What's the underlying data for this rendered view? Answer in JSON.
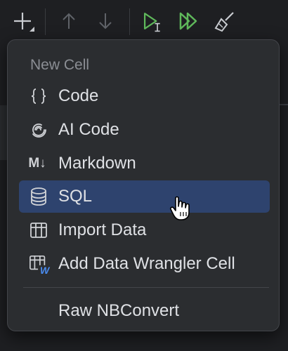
{
  "toolbar": {
    "buttons": [
      {
        "name": "add-cell-button",
        "icon": "plus-icon"
      },
      {
        "name": "move-up-button",
        "icon": "arrow-up-icon"
      },
      {
        "name": "move-down-button",
        "icon": "arrow-down-icon"
      },
      {
        "name": "run-cell-button",
        "icon": "run-cursor-icon"
      },
      {
        "name": "run-all-button",
        "icon": "run-all-icon"
      },
      {
        "name": "clear-outputs-button",
        "icon": "broom-icon"
      }
    ],
    "accent_green": "#5fb85b"
  },
  "menu": {
    "header": "New Cell",
    "items": [
      {
        "label": "Code",
        "icon": "braces-icon"
      },
      {
        "label": "AI Code",
        "icon": "ai-spiral-icon"
      },
      {
        "label": "Markdown",
        "icon": "markdown-icon"
      },
      {
        "label": "SQL",
        "icon": "database-icon",
        "selected": true
      },
      {
        "label": "Import Data",
        "icon": "table-icon"
      },
      {
        "label": "Add Data Wrangler Cell",
        "icon": "table-w-icon"
      },
      {
        "label": "Raw NBConvert",
        "icon": ""
      }
    ],
    "selected_bg": "#2e436e"
  },
  "icons": {
    "markdown_text": "M↓",
    "wrangler_text": "W"
  }
}
